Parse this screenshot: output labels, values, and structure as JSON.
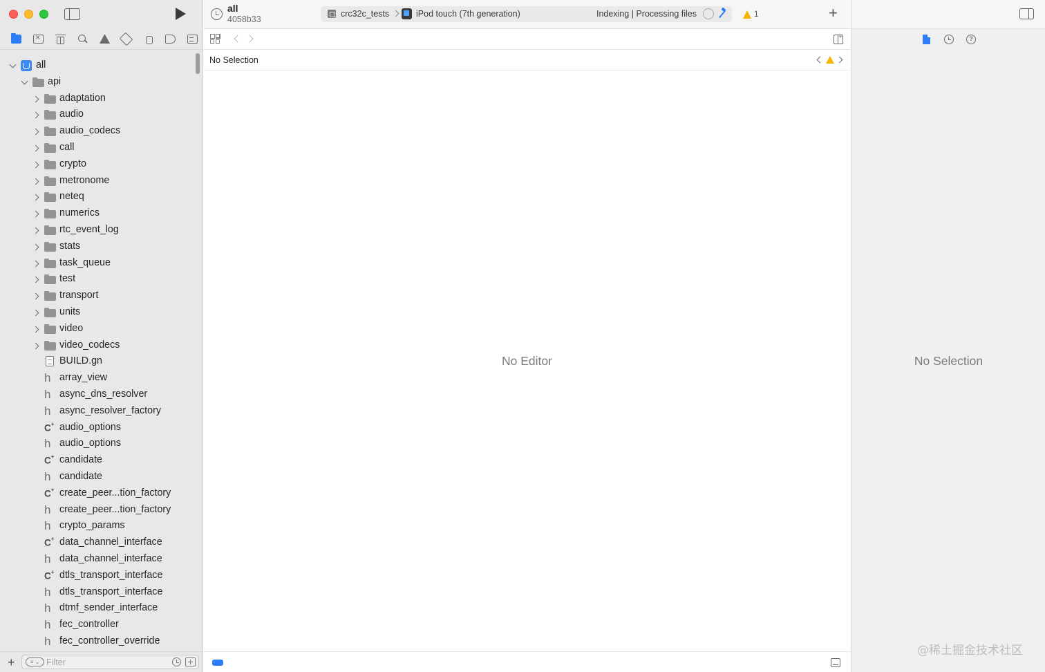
{
  "toolbar": {
    "project_title": "all",
    "commit": "4058b33",
    "scheme": "crc32c_tests",
    "device": "iPod touch (7th generation)",
    "status": "Indexing | Processing files",
    "warning_count": "1",
    "icons": {
      "history": "clock-icon",
      "run": "play-icon",
      "add": "plus-icon",
      "build": "hammer-icon"
    }
  },
  "navigator": {
    "tabs": [
      {
        "name": "project-navigator",
        "icon": "folder-icon",
        "selected": true
      },
      {
        "name": "source-control-navigator",
        "icon": "source-control-icon"
      },
      {
        "name": "symbol-navigator",
        "icon": "hierarchy-icon"
      },
      {
        "name": "find-navigator",
        "icon": "search-icon"
      },
      {
        "name": "issue-navigator",
        "icon": "warning-icon"
      },
      {
        "name": "test-navigator",
        "icon": "diamond-icon"
      },
      {
        "name": "debug-navigator",
        "icon": "spray-icon"
      },
      {
        "name": "breakpoint-navigator",
        "icon": "tag-icon"
      },
      {
        "name": "report-navigator",
        "icon": "list-icon"
      }
    ],
    "tree": [
      {
        "label": "all",
        "kind": "project",
        "depth": 0,
        "expanded": true
      },
      {
        "label": "api",
        "kind": "folder",
        "depth": 1,
        "expanded": true
      },
      {
        "label": "adaptation",
        "kind": "folder",
        "depth": 2
      },
      {
        "label": "audio",
        "kind": "folder",
        "depth": 2
      },
      {
        "label": "audio_codecs",
        "kind": "folder",
        "depth": 2
      },
      {
        "label": "call",
        "kind": "folder",
        "depth": 2
      },
      {
        "label": "crypto",
        "kind": "folder",
        "depth": 2
      },
      {
        "label": "metronome",
        "kind": "folder",
        "depth": 2
      },
      {
        "label": "neteq",
        "kind": "folder",
        "depth": 2
      },
      {
        "label": "numerics",
        "kind": "folder",
        "depth": 2
      },
      {
        "label": "rtc_event_log",
        "kind": "folder",
        "depth": 2
      },
      {
        "label": "stats",
        "kind": "folder",
        "depth": 2
      },
      {
        "label": "task_queue",
        "kind": "folder",
        "depth": 2
      },
      {
        "label": "test",
        "kind": "folder",
        "depth": 2
      },
      {
        "label": "transport",
        "kind": "folder",
        "depth": 2
      },
      {
        "label": "units",
        "kind": "folder",
        "depth": 2
      },
      {
        "label": "video",
        "kind": "folder",
        "depth": 2
      },
      {
        "label": "video_codecs",
        "kind": "folder",
        "depth": 2
      },
      {
        "label": "BUILD.gn",
        "kind": "file",
        "depth": 2
      },
      {
        "label": "array_view",
        "kind": "header",
        "depth": 2
      },
      {
        "label": "async_dns_resolver",
        "kind": "header",
        "depth": 2
      },
      {
        "label": "async_resolver_factory",
        "kind": "header",
        "depth": 2
      },
      {
        "label": "audio_options",
        "kind": "cpp",
        "depth": 2
      },
      {
        "label": "audio_options",
        "kind": "header",
        "depth": 2
      },
      {
        "label": "candidate",
        "kind": "cpp",
        "depth": 2
      },
      {
        "label": "candidate",
        "kind": "header",
        "depth": 2
      },
      {
        "label": "create_peer...tion_factory",
        "kind": "cpp",
        "depth": 2
      },
      {
        "label": "create_peer...tion_factory",
        "kind": "header",
        "depth": 2
      },
      {
        "label": "crypto_params",
        "kind": "header",
        "depth": 2
      },
      {
        "label": "data_channel_interface",
        "kind": "cpp",
        "depth": 2
      },
      {
        "label": "data_channel_interface",
        "kind": "header",
        "depth": 2
      },
      {
        "label": "dtls_transport_interface",
        "kind": "cpp",
        "depth": 2
      },
      {
        "label": "dtls_transport_interface",
        "kind": "header",
        "depth": 2
      },
      {
        "label": "dtmf_sender_interface",
        "kind": "header",
        "depth": 2
      },
      {
        "label": "fec_controller",
        "kind": "header",
        "depth": 2
      },
      {
        "label": "fec_controller_override",
        "kind": "header",
        "depth": 2
      }
    ],
    "glyphs": {
      "header": "h",
      "cpp": "C",
      "cpp_sup": "+"
    },
    "filter": {
      "placeholder": "Filter",
      "menu_glyph": "≡ ⌄"
    },
    "add_glyph": "+"
  },
  "editor": {
    "jump_bar_label": "No Selection",
    "empty_label": "No Editor"
  },
  "inspector": {
    "empty_label": "No Selection",
    "help_glyph": "?",
    "watermark": "@稀土掘金技术社区"
  },
  "colors": {
    "accent": "#2b7ef5",
    "warning": "#f5b400",
    "close": "#ff5f57",
    "minimize": "#febc2e",
    "zoom": "#28c840"
  }
}
